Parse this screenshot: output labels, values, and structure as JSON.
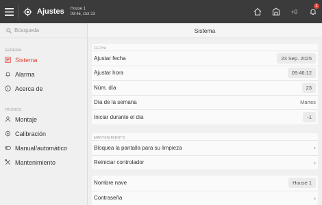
{
  "topbar": {
    "title": "Ajustes",
    "house_name": "House 1",
    "datetime": "09:46, Oct 23",
    "right_text": "+0",
    "badge": "1"
  },
  "sidebar": {
    "search_placeholder": "Búsqueda",
    "sections": [
      {
        "label": "GENERAL",
        "items": [
          {
            "label": "Sistema",
            "icon": "system-icon",
            "active": true
          },
          {
            "label": "Alarma",
            "icon": "bell-icon"
          },
          {
            "label": "Acerca de",
            "icon": "info-icon"
          }
        ]
      },
      {
        "label": "TÉCNICO",
        "items": [
          {
            "label": "Montaje",
            "icon": "person-icon"
          },
          {
            "label": "Calibración",
            "icon": "target-icon"
          },
          {
            "label": "Manual/automático",
            "icon": "toggle-icon"
          },
          {
            "label": "Mantenimiento",
            "icon": "tools-icon"
          }
        ]
      }
    ]
  },
  "main": {
    "title": "Sistema",
    "fecha": {
      "label": "FECHA",
      "rows": [
        {
          "label": "Ajustar fecha",
          "value": "23 Sep. 2025"
        },
        {
          "label": "Ajustar hora",
          "value": "09:46:12"
        },
        {
          "label": "Núm. día",
          "value": "23"
        },
        {
          "label": "Día de la semana",
          "value": "Martes"
        },
        {
          "label": "Iniciar durante el día",
          "value": "-1"
        }
      ]
    },
    "mantenimiento": {
      "label": "MANTENIMIENTO",
      "rows": [
        {
          "label": "Bloquea la pantalla para su limpieza"
        },
        {
          "label": "Reiniciar controlador"
        }
      ]
    },
    "nave": {
      "rows": [
        {
          "label": "Nombre nave",
          "value": "House 1"
        },
        {
          "label": "Contraseña"
        }
      ]
    }
  },
  "colors": {
    "accent": "#e0483b",
    "topbar": "#3b3b3b",
    "background": "#f0f0f0"
  }
}
